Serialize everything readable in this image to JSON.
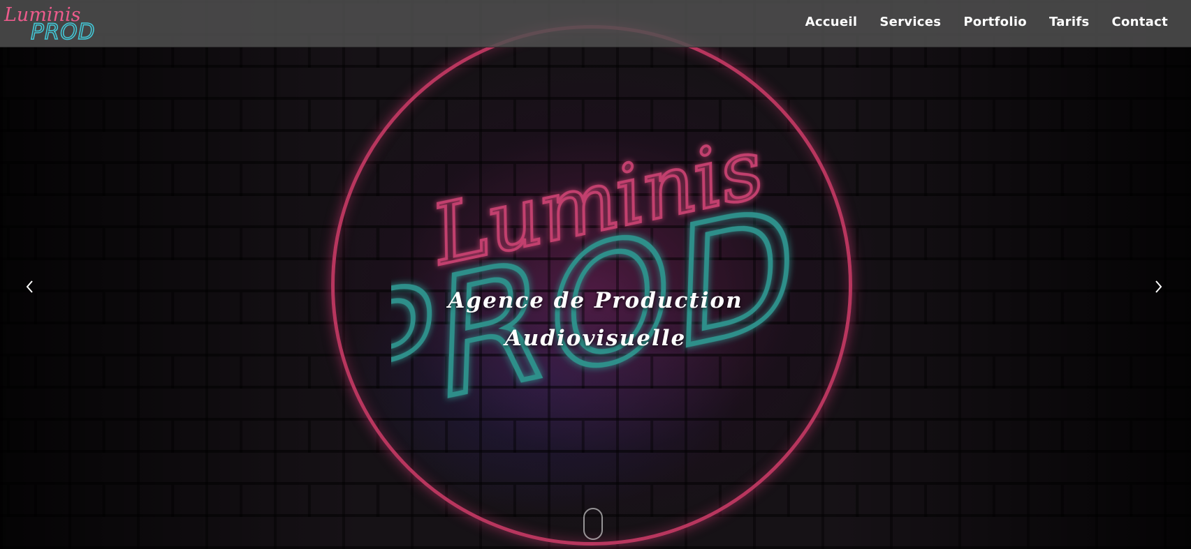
{
  "brand": {
    "logo_line1": "Luminis",
    "logo_line2": "PROD",
    "pink": "#e0407a",
    "cyan": "#3ec6d8"
  },
  "nav": {
    "items": [
      {
        "label": "Accueil"
      },
      {
        "label": "Services"
      },
      {
        "label": "Portfolio"
      },
      {
        "label": "Tarifs"
      },
      {
        "label": "Contact"
      }
    ]
  },
  "hero": {
    "neon_line1": "Luminis",
    "neon_line2": "PROD",
    "caption_line1": "Agence de Production",
    "caption_line2": "Audiovisuelle",
    "prev_icon": "chevron-left-icon",
    "next_icon": "chevron-right-icon",
    "scroll_icon": "mouse-scroll-icon"
  }
}
